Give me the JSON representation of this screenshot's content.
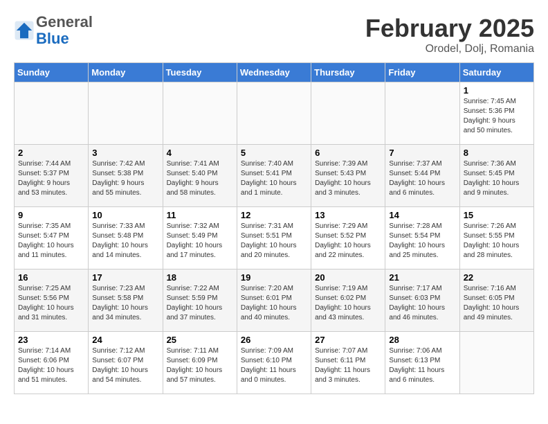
{
  "header": {
    "logo_general": "General",
    "logo_blue": "Blue",
    "month_title": "February 2025",
    "location": "Orodel, Dolj, Romania"
  },
  "days_of_week": [
    "Sunday",
    "Monday",
    "Tuesday",
    "Wednesday",
    "Thursday",
    "Friday",
    "Saturday"
  ],
  "weeks": [
    [
      {
        "day": "",
        "info": ""
      },
      {
        "day": "",
        "info": ""
      },
      {
        "day": "",
        "info": ""
      },
      {
        "day": "",
        "info": ""
      },
      {
        "day": "",
        "info": ""
      },
      {
        "day": "",
        "info": ""
      },
      {
        "day": "1",
        "info": "Sunrise: 7:45 AM\nSunset: 5:36 PM\nDaylight: 9 hours\nand 50 minutes."
      }
    ],
    [
      {
        "day": "2",
        "info": "Sunrise: 7:44 AM\nSunset: 5:37 PM\nDaylight: 9 hours\nand 53 minutes."
      },
      {
        "day": "3",
        "info": "Sunrise: 7:42 AM\nSunset: 5:38 PM\nDaylight: 9 hours\nand 55 minutes."
      },
      {
        "day": "4",
        "info": "Sunrise: 7:41 AM\nSunset: 5:40 PM\nDaylight: 9 hours\nand 58 minutes."
      },
      {
        "day": "5",
        "info": "Sunrise: 7:40 AM\nSunset: 5:41 PM\nDaylight: 10 hours\nand 1 minute."
      },
      {
        "day": "6",
        "info": "Sunrise: 7:39 AM\nSunset: 5:43 PM\nDaylight: 10 hours\nand 3 minutes."
      },
      {
        "day": "7",
        "info": "Sunrise: 7:37 AM\nSunset: 5:44 PM\nDaylight: 10 hours\nand 6 minutes."
      },
      {
        "day": "8",
        "info": "Sunrise: 7:36 AM\nSunset: 5:45 PM\nDaylight: 10 hours\nand 9 minutes."
      }
    ],
    [
      {
        "day": "9",
        "info": "Sunrise: 7:35 AM\nSunset: 5:47 PM\nDaylight: 10 hours\nand 11 minutes."
      },
      {
        "day": "10",
        "info": "Sunrise: 7:33 AM\nSunset: 5:48 PM\nDaylight: 10 hours\nand 14 minutes."
      },
      {
        "day": "11",
        "info": "Sunrise: 7:32 AM\nSunset: 5:49 PM\nDaylight: 10 hours\nand 17 minutes."
      },
      {
        "day": "12",
        "info": "Sunrise: 7:31 AM\nSunset: 5:51 PM\nDaylight: 10 hours\nand 20 minutes."
      },
      {
        "day": "13",
        "info": "Sunrise: 7:29 AM\nSunset: 5:52 PM\nDaylight: 10 hours\nand 22 minutes."
      },
      {
        "day": "14",
        "info": "Sunrise: 7:28 AM\nSunset: 5:54 PM\nDaylight: 10 hours\nand 25 minutes."
      },
      {
        "day": "15",
        "info": "Sunrise: 7:26 AM\nSunset: 5:55 PM\nDaylight: 10 hours\nand 28 minutes."
      }
    ],
    [
      {
        "day": "16",
        "info": "Sunrise: 7:25 AM\nSunset: 5:56 PM\nDaylight: 10 hours\nand 31 minutes."
      },
      {
        "day": "17",
        "info": "Sunrise: 7:23 AM\nSunset: 5:58 PM\nDaylight: 10 hours\nand 34 minutes."
      },
      {
        "day": "18",
        "info": "Sunrise: 7:22 AM\nSunset: 5:59 PM\nDaylight: 10 hours\nand 37 minutes."
      },
      {
        "day": "19",
        "info": "Sunrise: 7:20 AM\nSunset: 6:01 PM\nDaylight: 10 hours\nand 40 minutes."
      },
      {
        "day": "20",
        "info": "Sunrise: 7:19 AM\nSunset: 6:02 PM\nDaylight: 10 hours\nand 43 minutes."
      },
      {
        "day": "21",
        "info": "Sunrise: 7:17 AM\nSunset: 6:03 PM\nDaylight: 10 hours\nand 46 minutes."
      },
      {
        "day": "22",
        "info": "Sunrise: 7:16 AM\nSunset: 6:05 PM\nDaylight: 10 hours\nand 49 minutes."
      }
    ],
    [
      {
        "day": "23",
        "info": "Sunrise: 7:14 AM\nSunset: 6:06 PM\nDaylight: 10 hours\nand 51 minutes."
      },
      {
        "day": "24",
        "info": "Sunrise: 7:12 AM\nSunset: 6:07 PM\nDaylight: 10 hours\nand 54 minutes."
      },
      {
        "day": "25",
        "info": "Sunrise: 7:11 AM\nSunset: 6:09 PM\nDaylight: 10 hours\nand 57 minutes."
      },
      {
        "day": "26",
        "info": "Sunrise: 7:09 AM\nSunset: 6:10 PM\nDaylight: 11 hours\nand 0 minutes."
      },
      {
        "day": "27",
        "info": "Sunrise: 7:07 AM\nSunset: 6:11 PM\nDaylight: 11 hours\nand 3 minutes."
      },
      {
        "day": "28",
        "info": "Sunrise: 7:06 AM\nSunset: 6:13 PM\nDaylight: 11 hours\nand 6 minutes."
      },
      {
        "day": "",
        "info": ""
      }
    ]
  ]
}
